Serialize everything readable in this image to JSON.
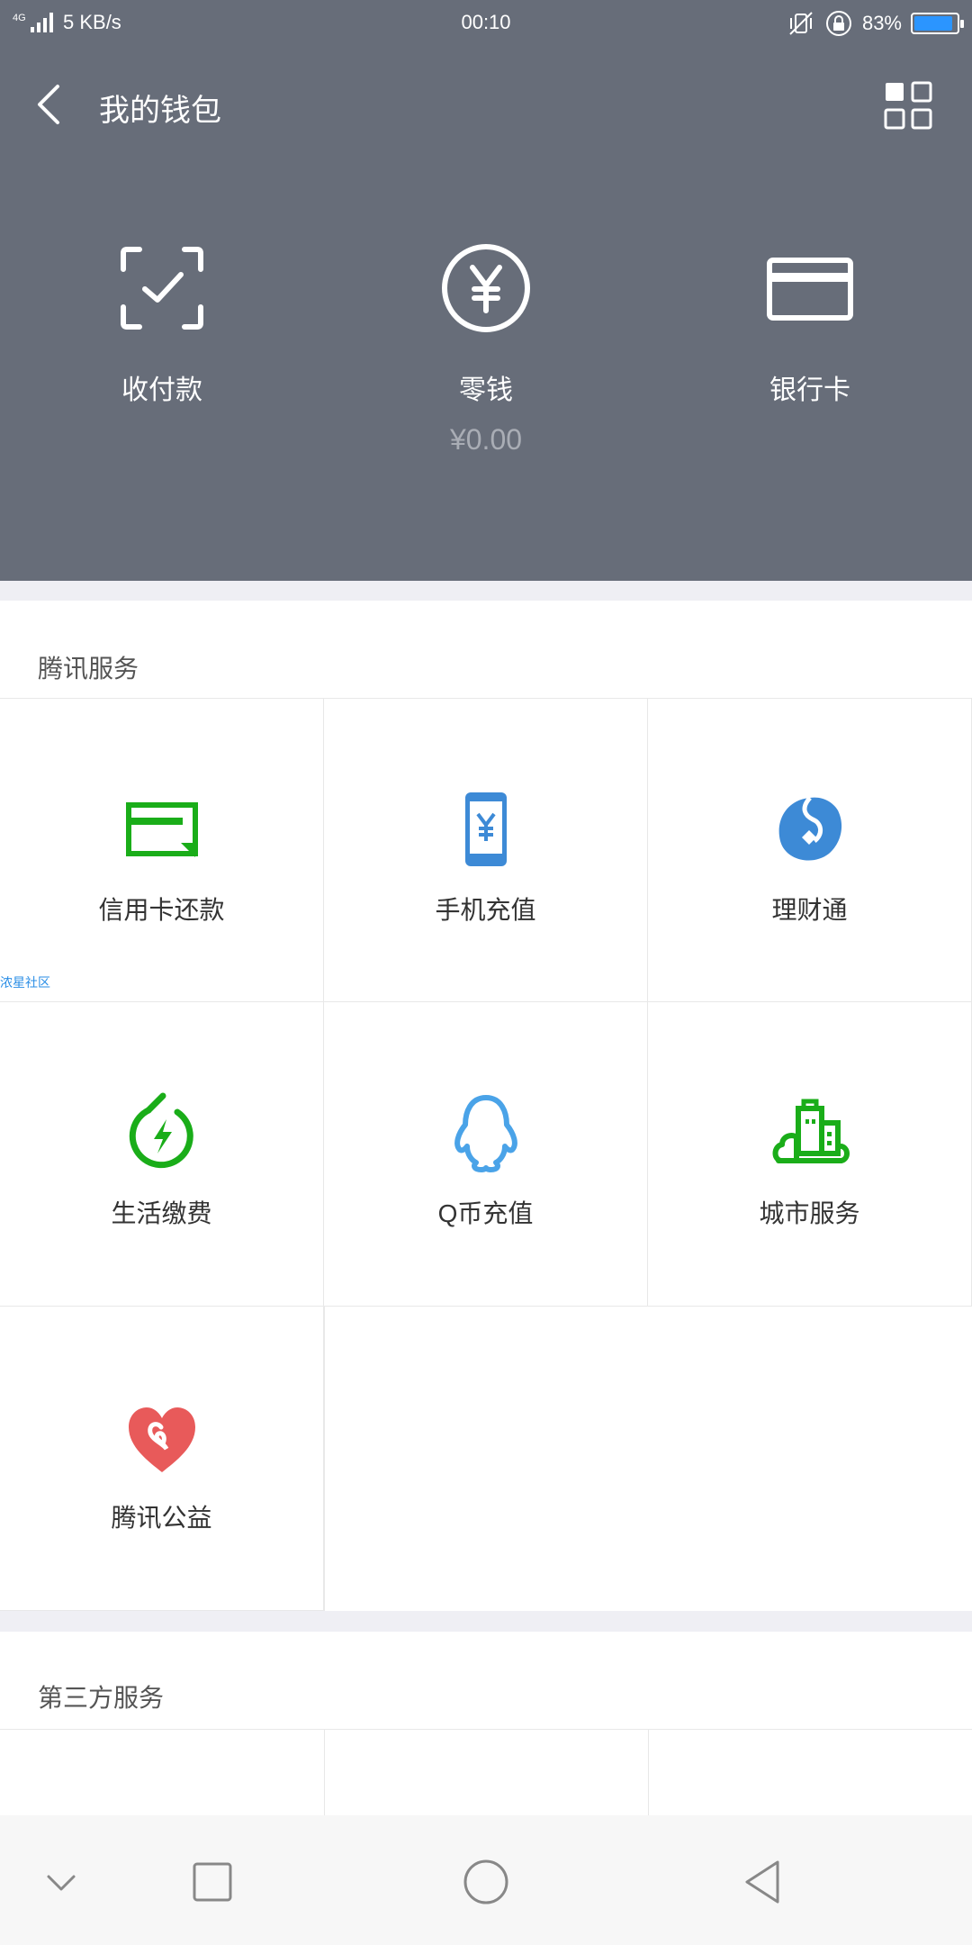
{
  "status_bar": {
    "signal": "4G",
    "speed": "5 KB/s",
    "time": "00:10",
    "battery": "83%",
    "battery_level": 0.83
  },
  "header": {
    "title": "我的钱包"
  },
  "top_actions": [
    {
      "label": "收付款",
      "icon": "scan-pay-icon"
    },
    {
      "label": "零钱",
      "sub": "¥0.00",
      "icon": "yuan-circle-icon"
    },
    {
      "label": "银行卡",
      "icon": "bank-card-icon"
    }
  ],
  "tencent_services": {
    "title": "腾讯服务",
    "items": [
      {
        "label": "信用卡还款",
        "icon": "credit-card-repay-icon",
        "color": "#1aad19"
      },
      {
        "label": "手机充值",
        "icon": "phone-recharge-icon",
        "color": "#3d8ad6"
      },
      {
        "label": "理财通",
        "icon": "licaitong-icon",
        "color": "#3d8ad6"
      },
      {
        "label": "生活缴费",
        "icon": "utility-bolt-icon",
        "color": "#1aad19"
      },
      {
        "label": "Q币充值",
        "icon": "qq-penguin-icon",
        "color": "#4aa3e8"
      },
      {
        "label": "城市服务",
        "icon": "city-service-icon",
        "color": "#1aad19"
      },
      {
        "label": "腾讯公益",
        "icon": "charity-heart-icon",
        "color": "#e85a5a"
      }
    ],
    "watermark": "浓星社区"
  },
  "third_party": {
    "title": "第三方服务"
  }
}
